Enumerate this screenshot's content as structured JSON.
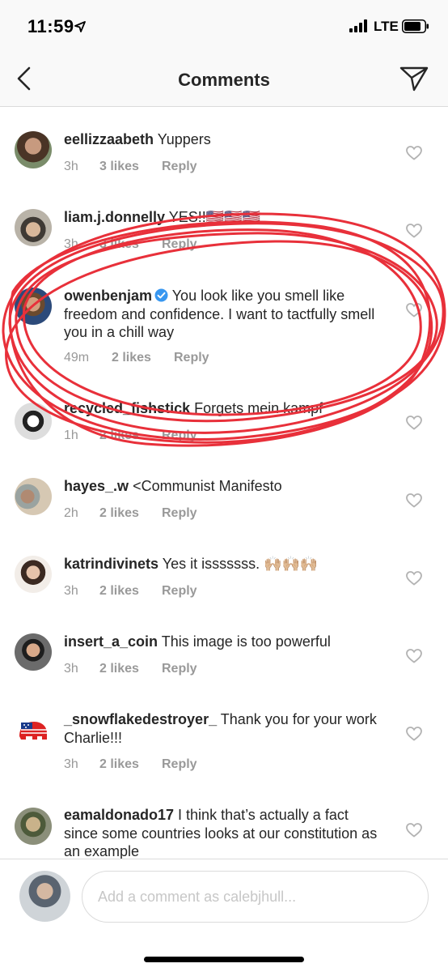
{
  "status": {
    "time": "11:59",
    "carrier": "LTE",
    "icons": [
      "location-arrow-icon",
      "signal-bars-icon",
      "battery-icon"
    ]
  },
  "nav": {
    "title": "Comments",
    "back_icon": "chevron-left-icon",
    "send_icon": "paper-plane-icon"
  },
  "comments": [
    {
      "username": "eellizzaabeth",
      "text": " Yuppers",
      "time": "3h",
      "likes": "3 likes",
      "reply": "Reply"
    },
    {
      "username": "liam.j.donnelly",
      "text": " YES!!🇺🇸🇺🇸🇺🇸",
      "time": "3h",
      "likes": "3 likes",
      "reply": "Reply"
    },
    {
      "username": "owenbenjam",
      "verified": true,
      "text": " You look like you smell like freedom and confidence. I want to tactfully smell you in a chill way",
      "time": "49m",
      "likes": "2 likes",
      "reply": "Reply"
    },
    {
      "username": "recycled_fishstick",
      "text": " Forgets mein kampf",
      "time": "1h",
      "likes": "2 likes",
      "reply": "Reply"
    },
    {
      "username": "hayes_.w",
      "text": " <Communist Manifesto",
      "time": "2h",
      "likes": "2 likes",
      "reply": "Reply"
    },
    {
      "username": "katrindivinets",
      "text": " Yes it isssssss. 🙌🏼🙌🏼🙌🏼",
      "time": "3h",
      "likes": "2 likes",
      "reply": "Reply"
    },
    {
      "username": "insert_a_coin",
      "text": " This image is too powerful",
      "time": "3h",
      "likes": "2 likes",
      "reply": "Reply"
    },
    {
      "username": "_snowflakedestroyer_",
      "text": " Thank you for your work Charlie!!!",
      "time": "3h",
      "likes": "2 likes",
      "reply": "Reply"
    },
    {
      "username": "eamaldonado17",
      "text": " I think that’s actually a fact since some countries looks at our constitution as an example",
      "time": "",
      "likes": "",
      "reply": ""
    }
  ],
  "input": {
    "placeholder": "Add a comment as calebjhull..."
  },
  "colors": {
    "annotation": "#e8303a",
    "meta_text": "#999999",
    "verified": "#3897f0"
  }
}
